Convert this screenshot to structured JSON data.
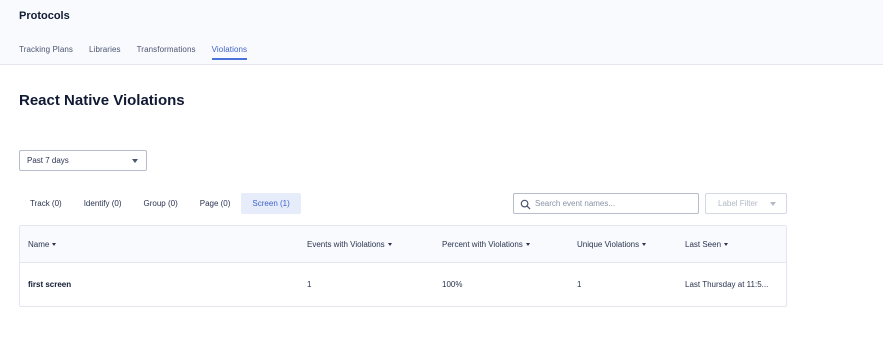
{
  "app": {
    "title": "Protocols"
  },
  "nav": {
    "tabs": [
      {
        "label": "Tracking Plans",
        "active": false
      },
      {
        "label": "Libraries",
        "active": false
      },
      {
        "label": "Transformations",
        "active": false
      },
      {
        "label": "Violations",
        "active": true
      }
    ]
  },
  "page": {
    "title": "React Native Violations"
  },
  "date_filter": {
    "value": "Past 7 days"
  },
  "event_tabs": [
    {
      "label": "Track (0)",
      "active": false
    },
    {
      "label": "Identify (0)",
      "active": false
    },
    {
      "label": "Group (0)",
      "active": false
    },
    {
      "label": "Page (0)",
      "active": false
    },
    {
      "label": "Screen (1)",
      "active": true
    }
  ],
  "search": {
    "placeholder": "Search event names...",
    "icon": "search-icon"
  },
  "label_filter": {
    "value": "Label Filter"
  },
  "table": {
    "columns": [
      "Name",
      "Events with Violations",
      "Percent with Violations",
      "Unique Violations",
      "Last Seen"
    ],
    "rows": [
      [
        "first screen",
        "1",
        "100%",
        "1",
        "Last Thursday at 11:5..."
      ]
    ]
  },
  "colors": {
    "accent": "#3e63c8",
    "header_bg": "#f9fafd",
    "active_tab_bg": "#e6ecfa"
  }
}
